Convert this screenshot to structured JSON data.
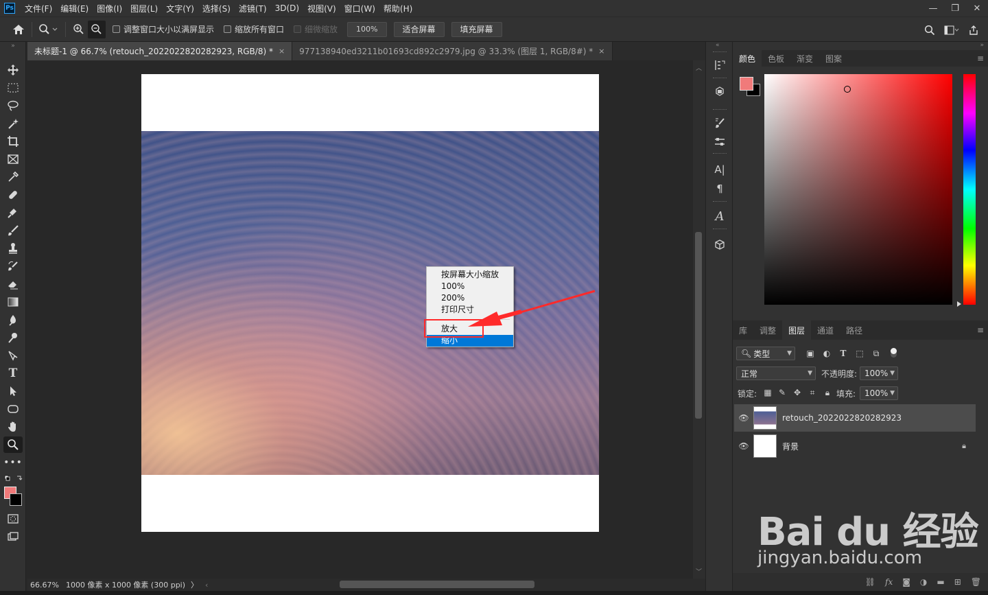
{
  "menubar": {
    "logo": "Ps",
    "items": [
      "文件(F)",
      "编辑(E)",
      "图像(I)",
      "图层(L)",
      "文字(Y)",
      "选择(S)",
      "滤镜(T)",
      "3D(D)",
      "视图(V)",
      "窗口(W)",
      "帮助(H)"
    ]
  },
  "window_controls": {
    "minimize": "—",
    "restore": "❐",
    "close": "✕"
  },
  "options": {
    "resize_windows": "调整窗口大小以满屏显示",
    "zoom_all": "缩放所有窗口",
    "scrubby_zoom": "细微缩放",
    "zoom_100": "100%",
    "fit_screen": "适合屏幕",
    "fill_screen": "填充屏幕"
  },
  "tabs": [
    {
      "label": "未标题-1 @ 66.7% (retouch_2022022820282923, RGB/8) *",
      "close": "×"
    },
    {
      "label": "977138940ed3211b01693cd892c2979.jpg @ 33.3% (图层 1, RGB/8#) *",
      "close": "×"
    }
  ],
  "status": {
    "zoom": "66.67%",
    "doc_info": "1000 像素 x 1000 像素 (300 ppi)",
    "more": "〉"
  },
  "context_menu": {
    "items": [
      "按屏幕大小缩放",
      "100%",
      "200%",
      "打印尺寸",
      "放大",
      "缩小"
    ],
    "selected": "缩小"
  },
  "color_panel": {
    "tabs": [
      "颜色",
      "色板",
      "渐变",
      "图案"
    ],
    "active_tab": "颜色",
    "foreground": "#f07a7a",
    "background": "#000000"
  },
  "layers_panel": {
    "tabs": [
      "库",
      "调整",
      "图层",
      "通道",
      "路径"
    ],
    "active_tab": "图层",
    "filter_kind": "类型",
    "blend_mode": "正常",
    "opacity_label": "不透明度:",
    "opacity": "100%",
    "lock_label": "锁定:",
    "fill_label": "填充:",
    "fill": "100%",
    "layers": [
      {
        "name": "retouch_2022022820282923",
        "selected": true
      },
      {
        "name": "背景",
        "selected": false,
        "locked": true
      }
    ],
    "footer_icons": [
      "link-icon",
      "fx-icon",
      "mask-icon",
      "adjustment-icon",
      "group-icon",
      "new-layer-icon",
      "trash-icon"
    ]
  },
  "watermark": {
    "logo": "Bai du 经验",
    "url": "jingyan.baidu.com"
  }
}
